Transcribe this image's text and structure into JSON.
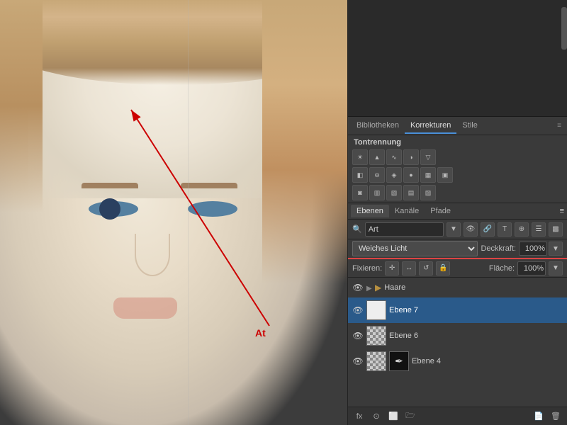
{
  "tabs": {
    "bibliotheken": "Bibliotheken",
    "korrekturen": "Korrekturen",
    "stile": "Stile",
    "active": "korrekturen"
  },
  "tontrennung": {
    "label": "Tontrennung"
  },
  "layer_tabs": {
    "ebenen": "Ebenen",
    "kanaele": "Kanäle",
    "pfade": "Pfade",
    "active": "ebenen"
  },
  "layer_controls": {
    "search_placeholder": "Art",
    "search_value": "Art"
  },
  "blend_mode": {
    "label": "Weiches Licht",
    "opacity_label": "Deckkraft:",
    "opacity_value": "100%",
    "area_label": "Fläche:",
    "area_value": "100%"
  },
  "fix_row": {
    "label": "Fixieren:"
  },
  "layers": [
    {
      "name": "Haare",
      "type": "group",
      "visible": true,
      "expanded": false
    },
    {
      "name": "Ebene 7",
      "type": "layer",
      "visible": true,
      "selected": true,
      "thumb": "white"
    },
    {
      "name": "Ebene 6",
      "type": "layer",
      "visible": true,
      "selected": false,
      "thumb": "checker"
    },
    {
      "name": "Ebene 4",
      "type": "layer",
      "visible": true,
      "selected": false,
      "thumb": "checker",
      "has_mask": true
    }
  ],
  "bottom_bar": {
    "fx": "fx",
    "circle": "○",
    "folder": "🗁",
    "trash": "🗑"
  },
  "icons": {
    "sun": "☀",
    "mountain": "⛰",
    "wave": "〜",
    "chart": "📊",
    "triangle_down": "▽",
    "brightness": "◑",
    "contrast": "◐",
    "hue": "◍",
    "balance": "⊖",
    "bw": "◈",
    "gradient": "▦",
    "curve": "∿",
    "levels": "≡",
    "exposure": "◌",
    "vibrance": "❋",
    "colorlookup": "▣",
    "invert": "◙",
    "posterize": "▥",
    "threshold": "▧",
    "gradient_map": "▤",
    "selective_color": "▨",
    "pen": "✒",
    "arrow": "↗",
    "lock": "🔒",
    "transform": "⊕",
    "eye": "👁"
  },
  "red_arrow": {
    "label": "At"
  }
}
